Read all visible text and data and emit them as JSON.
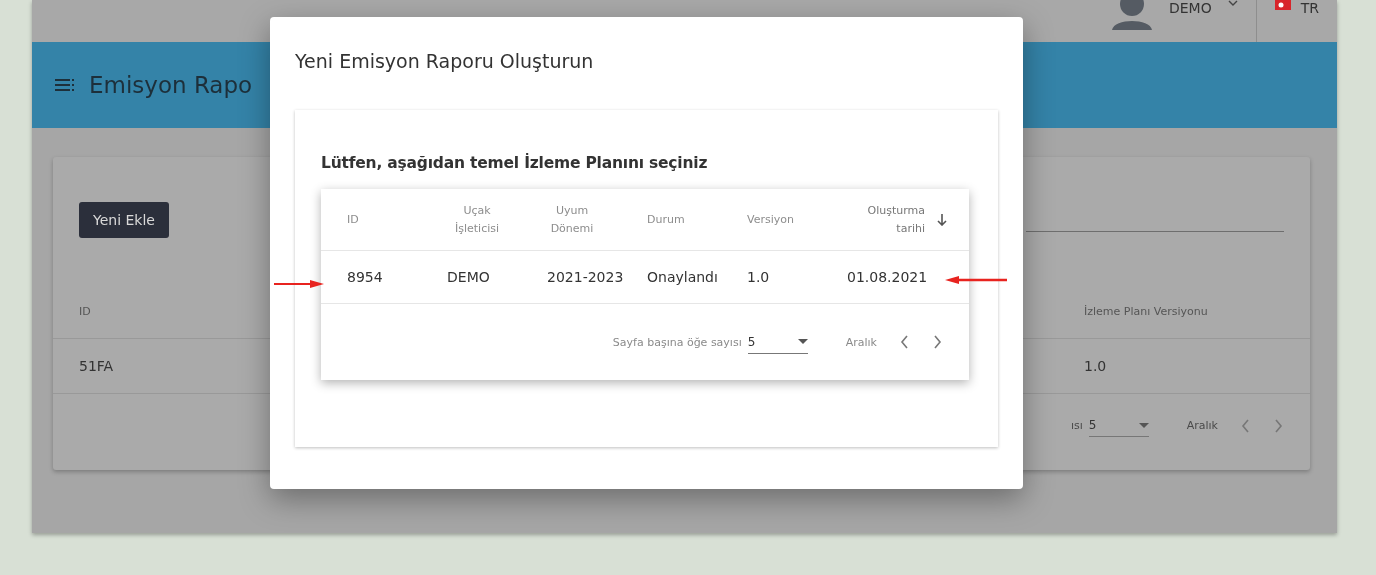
{
  "topbar": {
    "user": "DEMO",
    "language": "TR"
  },
  "header": {
    "title": "Emisyon Rapo"
  },
  "background_card": {
    "add_button": "Yeni Ekle",
    "columns": [
      "ID",
      "İzleme Planı Versiyonu"
    ],
    "rows": [
      [
        "51FA",
        "1.0"
      ]
    ],
    "pagination": {
      "per_page_label": "ısı",
      "per_page_value": "5",
      "range_label": "Aralık"
    }
  },
  "modal": {
    "title": "Yeni Emisyon Raporu Oluşturun",
    "prompt": "Lütfen, aşağıdan temel İzleme Planını seçiniz",
    "table": {
      "columns": [
        {
          "label": "ID",
          "sorted": false
        },
        {
          "label": "Uçak İşleticisi",
          "sorted": false
        },
        {
          "label": "Uyum Dönemi",
          "sorted": false
        },
        {
          "label": "Durum",
          "sorted": false
        },
        {
          "label": "Versiyon",
          "sorted": false
        },
        {
          "label": "Oluşturma tarihi",
          "sorted": true
        }
      ],
      "rows": [
        [
          "8954",
          "DEMO",
          "2021-2023",
          "Onaylandı",
          "1.0",
          "01.08.2021"
        ]
      ],
      "pagination": {
        "per_page_label": "Sayfa başına öğe sayısı",
        "per_page_value": "5",
        "range_label": "Aralık"
      }
    }
  }
}
